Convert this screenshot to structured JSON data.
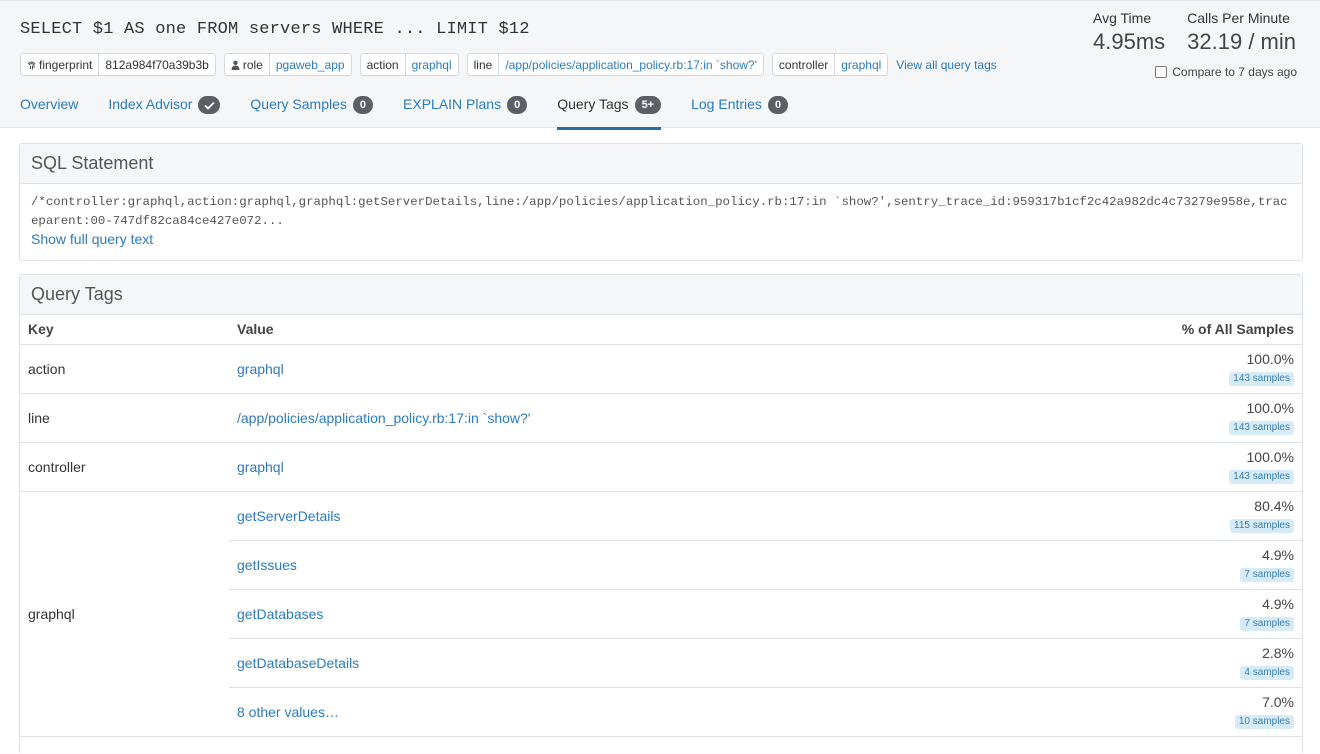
{
  "header": {
    "query_title": "SELECT $1 AS one FROM servers WHERE ... LIMIT $12",
    "tags": [
      {
        "key": "fingerprint",
        "value": "812a984f70a39b3b",
        "icon": "fingerprint-icon",
        "link": false
      },
      {
        "key": "role",
        "value": "pgaweb_app",
        "icon": "user-icon",
        "link": true
      },
      {
        "key": "action",
        "value": "graphql",
        "link": true
      },
      {
        "key": "line",
        "value": "/app/policies/application_policy.rb:17:in `show?'",
        "link": true
      },
      {
        "key": "controller",
        "value": "graphql",
        "link": true
      }
    ],
    "view_all_label": "View all query tags",
    "metrics": {
      "avg_time_label": "Avg Time",
      "avg_time_value": "4.95ms",
      "calls_label": "Calls Per Minute",
      "calls_value": "32.19 / min"
    },
    "compare_label": "Compare to 7 days ago"
  },
  "tabs": [
    {
      "label": "Overview",
      "badge": null
    },
    {
      "label": "Index Advisor",
      "badge": "check"
    },
    {
      "label": "Query Samples",
      "badge": "0"
    },
    {
      "label": "EXPLAIN Plans",
      "badge": "0"
    },
    {
      "label": "Query Tags",
      "badge": "5+",
      "active": true
    },
    {
      "label": "Log Entries",
      "badge": "0"
    }
  ],
  "sql_panel": {
    "title": "SQL Statement",
    "text": "/*controller:graphql,action:graphql,graphql:getServerDetails,line:/app/policies/application_policy.rb:17:in `show?',sentry_trace_id:959317b1cf2c42a982dc4c73279e958e,traceparent:00-747df82ca84ce427e072...",
    "show_full_label": "Show full query text"
  },
  "tags_panel": {
    "title": "Query Tags",
    "columns": {
      "key": "Key",
      "value": "Value",
      "pct": "% of All Samples"
    },
    "rows": [
      {
        "key": "action",
        "values": [
          {
            "value": "graphql",
            "pct": "100.0%",
            "samples": "143 samples"
          }
        ]
      },
      {
        "key": "line",
        "values": [
          {
            "value": "/app/policies/application_policy.rb:17:in `show?'",
            "pct": "100.0%",
            "samples": "143 samples"
          }
        ]
      },
      {
        "key": "controller",
        "values": [
          {
            "value": "graphql",
            "pct": "100.0%",
            "samples": "143 samples"
          }
        ]
      },
      {
        "key": "graphql",
        "values": [
          {
            "value": "getServerDetails",
            "pct": "80.4%",
            "samples": "115 samples"
          },
          {
            "value": "getIssues",
            "pct": "4.9%",
            "samples": "7 samples"
          },
          {
            "value": "getDatabases",
            "pct": "4.9%",
            "samples": "7 samples"
          },
          {
            "value": "getDatabaseDetails",
            "pct": "2.8%",
            "samples": "4 samples"
          },
          {
            "value": "8 other values…",
            "pct": "7.0%",
            "samples": "10 samples"
          }
        ]
      }
    ]
  },
  "colors": {
    "link": "#2b7bbf",
    "badge": "#5c6066",
    "samples_bg": "#d7ebf6",
    "active_tab_underline": "#2b6fa8"
  }
}
